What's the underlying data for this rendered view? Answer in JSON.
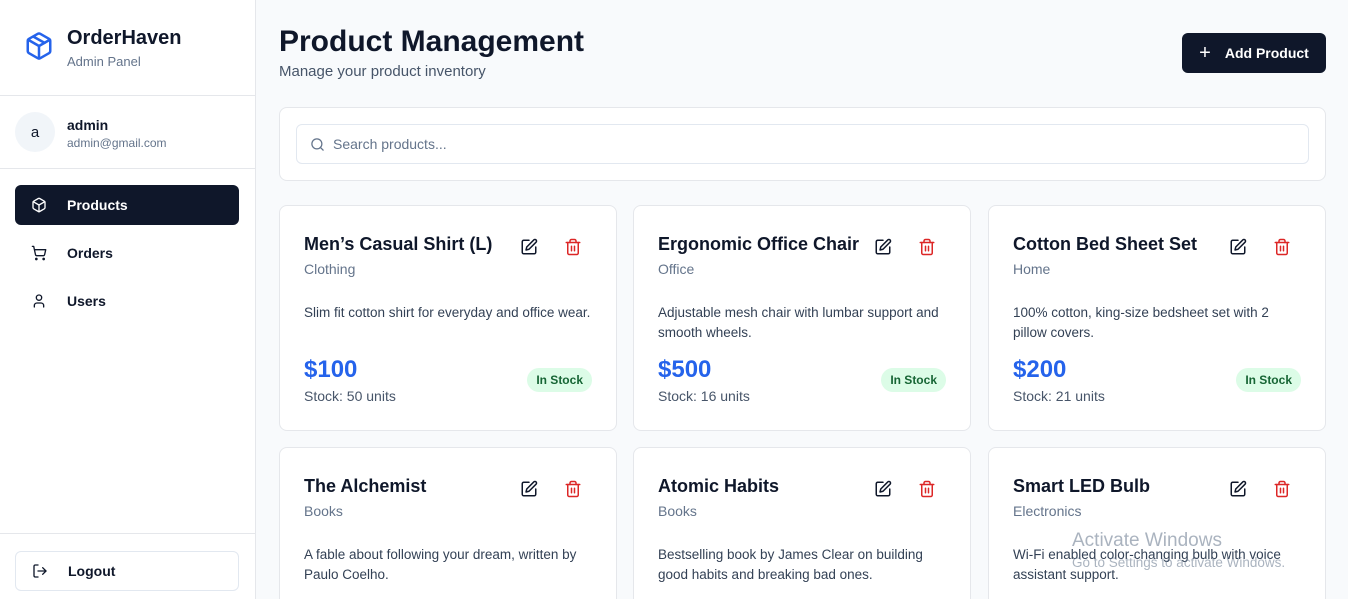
{
  "brand": {
    "title": "OrderHaven",
    "subtitle": "Admin Panel"
  },
  "user": {
    "initial": "a",
    "name": "admin",
    "email": "admin@gmail.com"
  },
  "nav": {
    "items": [
      {
        "label": "Products",
        "icon": "package-icon",
        "active": true
      },
      {
        "label": "Orders",
        "icon": "cart-icon",
        "active": false
      },
      {
        "label": "Users",
        "icon": "user-icon",
        "active": false
      }
    ],
    "logout_label": "Logout"
  },
  "header": {
    "title": "Product Management",
    "subtitle": "Manage your product inventory",
    "add_label": "Add Product"
  },
  "search": {
    "placeholder": "Search products..."
  },
  "products": [
    {
      "name": "Men’s Casual Shirt (L)",
      "category": "Clothing",
      "description": "Slim fit cotton shirt for everyday and office wear.",
      "price": "$100",
      "stock": "Stock: 50 units",
      "status": "In Stock"
    },
    {
      "name": "Ergonomic Office Chair",
      "category": "Office",
      "description": "Adjustable mesh chair with lumbar support and smooth wheels.",
      "price": "$500",
      "stock": "Stock: 16 units",
      "status": "In Stock"
    },
    {
      "name": "Cotton Bed Sheet Set",
      "category": "Home",
      "description": "100% cotton, king-size bedsheet set with 2 pillow covers.",
      "price": "$200",
      "stock": "Stock: 21 units",
      "status": "In Stock"
    },
    {
      "name": "The Alchemist",
      "category": "Books",
      "description": "A fable about following your dream, written by Paulo Coelho."
    },
    {
      "name": "Atomic Habits",
      "category": "Books",
      "description": "Bestselling book by James Clear on building good habits and breaking bad ones."
    },
    {
      "name": "Smart LED Bulb",
      "category": "Electronics",
      "description": "Wi-Fi enabled color-changing bulb with voice assistant support."
    }
  ],
  "watermark": {
    "line1": "Activate Windows",
    "line2": "Go to Settings to activate Windows."
  },
  "colors": {
    "primary": "#0f172a",
    "price": "#2563eb",
    "badge_bg": "#dcfce7",
    "badge_text": "#166534",
    "delete": "#dc2626"
  }
}
